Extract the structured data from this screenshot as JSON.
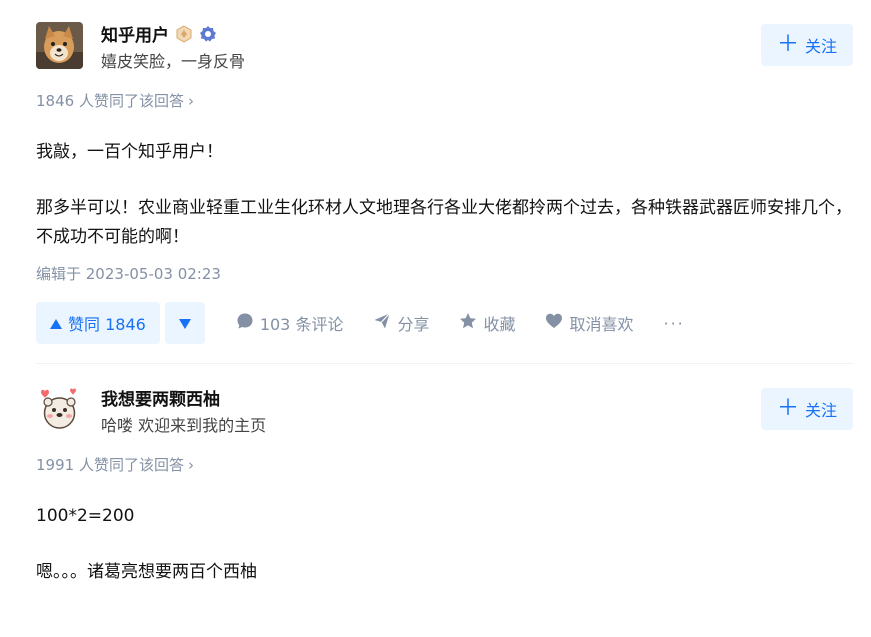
{
  "answers": [
    {
      "author_name": "知乎用户",
      "author_bio": "嬉皮笑脸，一身反骨",
      "follow_label": "关注",
      "upvote_summary": "1846 人赞同了该回答",
      "paragraphs": [
        "我敲，一百个知乎用户！",
        "那多半可以！农业商业轻重工业生化环材人文地理各行各业大佬都拎两个过去，各种铁器武器匠师安排几个，不成功不可能的啊！"
      ],
      "edited": "编辑于 2023-05-03 02:23",
      "actions": {
        "upvote": "赞同 1846",
        "comments": "103 条评论",
        "share": "分享",
        "favorite": "收藏",
        "unlike": "取消喜欢",
        "more": "···"
      }
    },
    {
      "author_name": "我想要两颗西柚",
      "author_bio": "哈喽 欢迎来到我的主页",
      "follow_label": "关注",
      "upvote_summary": "1991 人赞同了该回答",
      "paragraphs": [
        "100*2=200",
        "嗯。。。诸葛亮想要两百个西柚"
      ]
    }
  ],
  "colors": {
    "accent": "#1772f6",
    "accent_bg": "#ebf5ff",
    "meta": "#8491a5"
  },
  "icons": {
    "upvote": "triangle-up-icon",
    "downvote": "triangle-down-icon",
    "comment": "comment-bubble-icon",
    "share": "paper-plane-icon",
    "favorite": "star-icon",
    "like": "heart-icon",
    "follow": "plus-icon",
    "chevron": "chevron-right-icon"
  }
}
